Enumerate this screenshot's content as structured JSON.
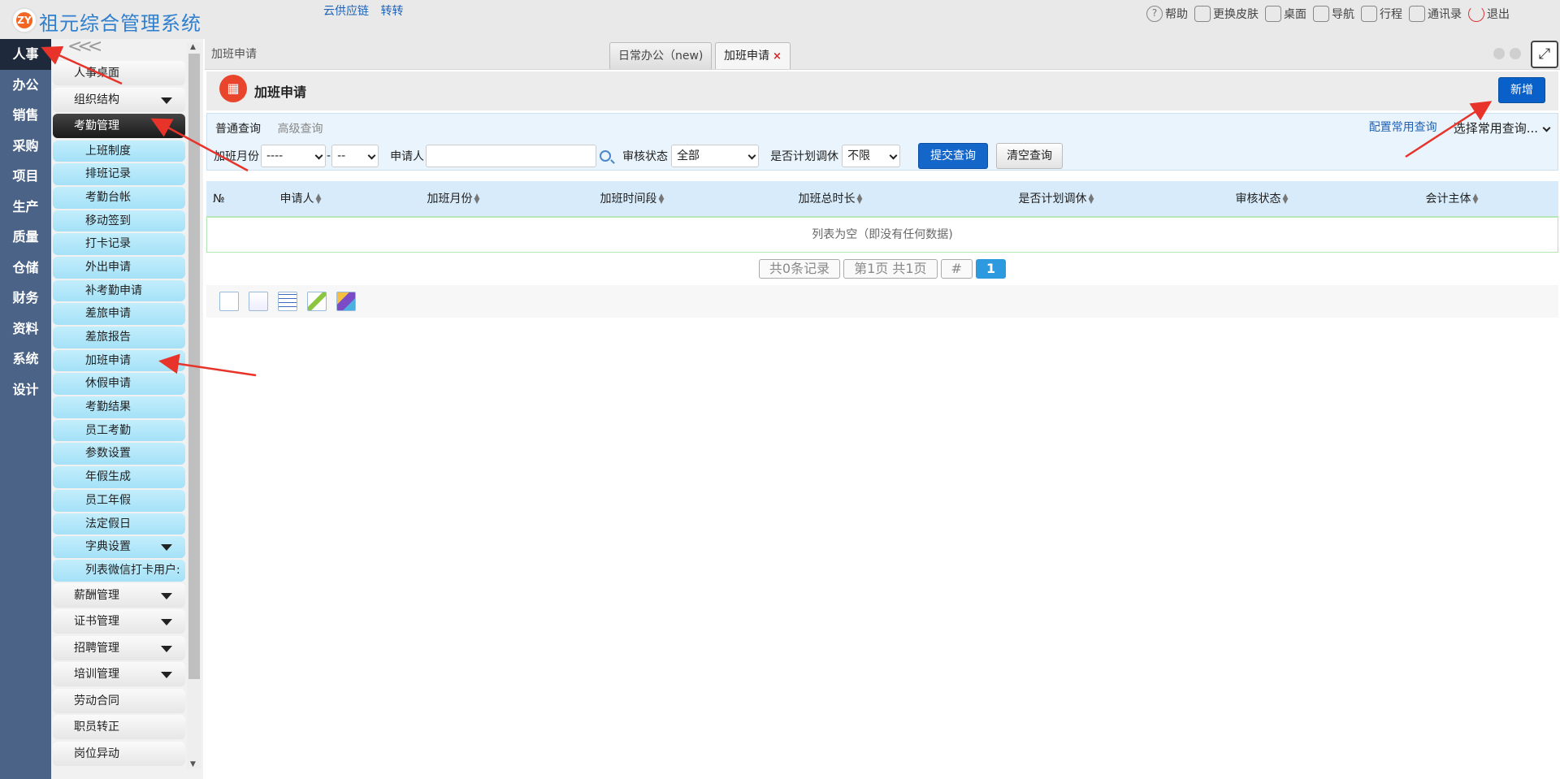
{
  "app": {
    "title": "祖元综合管理系统",
    "logo_mark": "ZY",
    "top_links": [
      "云供应链",
      "转转"
    ]
  },
  "top_actions": [
    {
      "label": "帮助",
      "icon": "help-icon"
    },
    {
      "label": "更换皮肤",
      "icon": "shirt-icon"
    },
    {
      "label": "桌面",
      "icon": "home-icon"
    },
    {
      "label": "导航",
      "icon": "grid-icon"
    },
    {
      "label": "行程",
      "icon": "calendar-icon"
    },
    {
      "label": "通讯录",
      "icon": "contacts-icon"
    },
    {
      "label": "退出",
      "icon": "power-icon"
    }
  ],
  "rail": {
    "items": [
      "人事",
      "办公",
      "销售",
      "采购",
      "项目",
      "生产",
      "质量",
      "仓储",
      "财务",
      "资料",
      "系统",
      "设计"
    ],
    "active": "人事"
  },
  "sidebar": {
    "collapse_glyph": "<<<",
    "menu": [
      {
        "label": "人事桌面",
        "type": "group"
      },
      {
        "label": "组织结构",
        "type": "group",
        "caret": true
      },
      {
        "label": "考勤管理",
        "type": "group-open"
      },
      {
        "label": "上班制度",
        "type": "sub"
      },
      {
        "label": "排班记录",
        "type": "sub"
      },
      {
        "label": "考勤台帐",
        "type": "sub"
      },
      {
        "label": "移动签到",
        "type": "sub"
      },
      {
        "label": "打卡记录",
        "type": "sub"
      },
      {
        "label": "外出申请",
        "type": "sub"
      },
      {
        "label": "补考勤申请",
        "type": "sub"
      },
      {
        "label": "差旅申请",
        "type": "sub"
      },
      {
        "label": "差旅报告",
        "type": "sub"
      },
      {
        "label": "加班申请",
        "type": "sub"
      },
      {
        "label": "休假申请",
        "type": "sub"
      },
      {
        "label": "考勤结果",
        "type": "sub"
      },
      {
        "label": "员工考勤",
        "type": "sub"
      },
      {
        "label": "参数设置",
        "type": "sub"
      },
      {
        "label": "年假生成",
        "type": "sub"
      },
      {
        "label": "员工年假",
        "type": "sub"
      },
      {
        "label": "法定假日",
        "type": "sub"
      },
      {
        "label": "字典设置",
        "type": "sub",
        "caret": true
      },
      {
        "label": "列表微信打卡用户:",
        "type": "sub"
      },
      {
        "label": "薪酬管理",
        "type": "group",
        "caret": true
      },
      {
        "label": "证书管理",
        "type": "group",
        "caret": true
      },
      {
        "label": "招聘管理",
        "type": "group",
        "caret": true
      },
      {
        "label": "培训管理",
        "type": "group",
        "caret": true
      },
      {
        "label": "劳动合同",
        "type": "group"
      },
      {
        "label": "职员转正",
        "type": "group"
      },
      {
        "label": "岗位异动",
        "type": "group"
      }
    ]
  },
  "tabs": {
    "breadcrumb": "加班申请",
    "items": [
      {
        "label": "日常办公（new)",
        "active": false
      },
      {
        "label": "加班申请",
        "active": true,
        "close": "×"
      }
    ]
  },
  "page": {
    "title": "加班申请",
    "add_button": "新增"
  },
  "query": {
    "tab_normal": "普通查询",
    "tab_advanced": "高级查询",
    "config_link": "配置常用查询",
    "saved_query_select": "选择常用查询...",
    "month_label": "加班月份",
    "month_year_value": "----",
    "month_sep": "-",
    "month_month_value": "--",
    "applicant_label": "申请人",
    "applicant_value": "",
    "status_label": "审核状态",
    "status_value": "全部",
    "planned_label": "是否计划调休",
    "planned_value": "不限",
    "submit_button": "提交查询",
    "clear_button": "清空查询"
  },
  "table": {
    "columns": [
      "№",
      "申请人",
      "加班月份",
      "加班时间段",
      "加班总时长",
      "是否计划调休",
      "审核状态",
      "会计主体"
    ],
    "empty_text": "列表为空（即没有任何数据)"
  },
  "pager": {
    "total": "共0条记录",
    "page_info": "第1页 共1页",
    "jump": "#",
    "current": "1"
  },
  "toolbar_icons": [
    "select-all-icon",
    "blank-page-icon",
    "table-icon",
    "edit-icon",
    "puzzle-icon"
  ],
  "colors": {
    "rail_bg": "#4a6387",
    "accent_blue": "#0a60c9",
    "annotation_red": "#e8332a"
  }
}
